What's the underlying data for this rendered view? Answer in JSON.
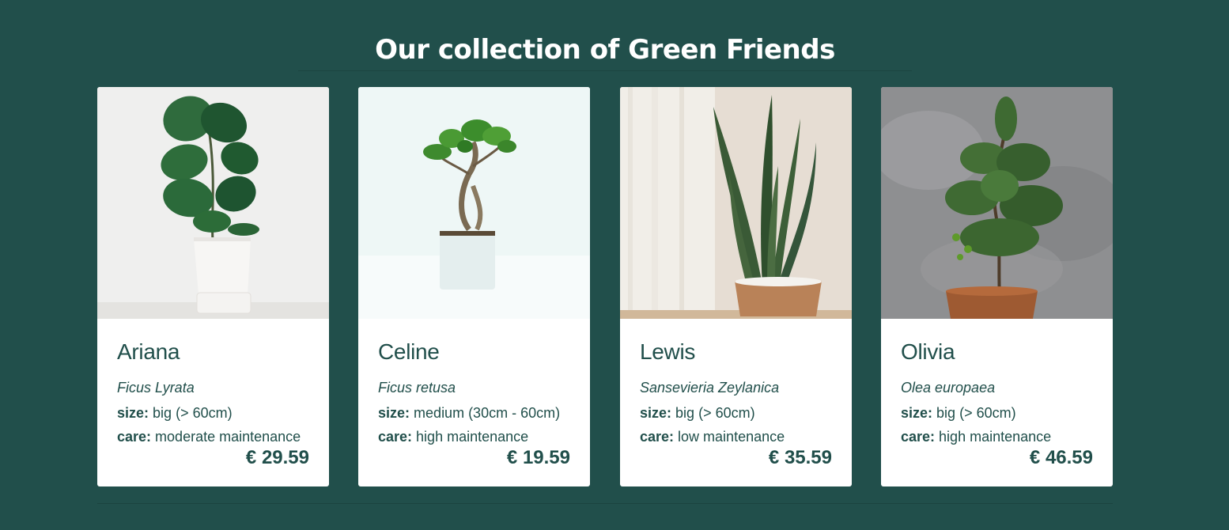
{
  "header": {
    "title": "Our collection of Green Friends"
  },
  "colors": {
    "background": "#214f4b",
    "card": "#ffffff",
    "text": "#214f4b"
  },
  "plants": [
    {
      "name": "Ariana",
      "latin": "Ficus Lyrata",
      "size_label": "size:",
      "size": "big (> 60cm)",
      "care_label": "care:",
      "care": "moderate maintenance",
      "price": "€ 29.59",
      "image_icon": "fiddle-leaf-fig-photo"
    },
    {
      "name": "Celine",
      "latin": "Ficus retusa",
      "size_label": "size:",
      "size": "medium (30cm - 60cm)",
      "care_label": "care:",
      "care": "high maintenance",
      "price": "€ 19.59",
      "image_icon": "bonsai-photo"
    },
    {
      "name": "Lewis",
      "latin": "Sansevieria Zeylanica",
      "size_label": "size:",
      "size": "big (> 60cm)",
      "care_label": "care:",
      "care": "low maintenance",
      "price": "€ 35.59",
      "image_icon": "snake-plant-photo"
    },
    {
      "name": "Olivia",
      "latin": "Olea europaea",
      "size_label": "size:",
      "size": "big (> 60cm)",
      "care_label": "care:",
      "care": "high maintenance",
      "price": "€ 46.59",
      "image_icon": "olive-tree-photo"
    }
  ]
}
